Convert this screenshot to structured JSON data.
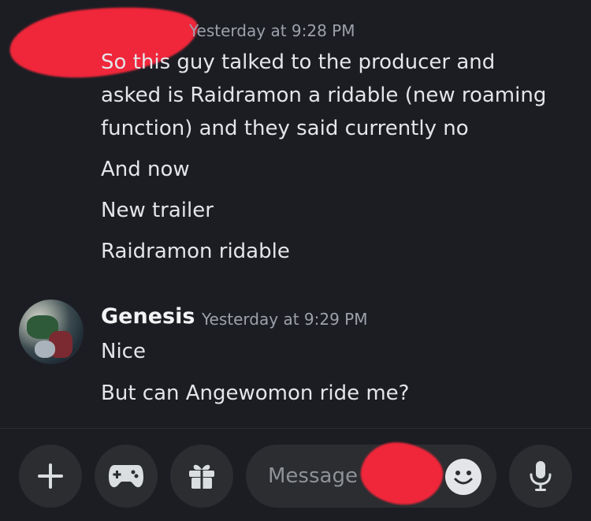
{
  "top_message": {
    "timestamp": "Yesterday at 9:28 PM",
    "lines": [
      "So this guy talked to the producer and",
      "asked is Raidramon a ridable (new roaming",
      "function) and they said currently no",
      "And now",
      "New trailer",
      "Raidramon ridable"
    ]
  },
  "second_message": {
    "author": "Genesis",
    "timestamp": "Yesterday at 9:29 PM",
    "lines": [
      "Nice",
      "But can Angewomon ride me?"
    ]
  },
  "composer": {
    "placeholder": "Message",
    "icons": [
      "plus-icon",
      "gamepad-icon",
      "gift-icon",
      "emoji-icon",
      "microphone-icon"
    ]
  },
  "colors": {
    "background": "#1c1d23",
    "button_bg": "#2b2d31",
    "redaction": "#f0263a",
    "timestamp": "#9da1aa"
  }
}
